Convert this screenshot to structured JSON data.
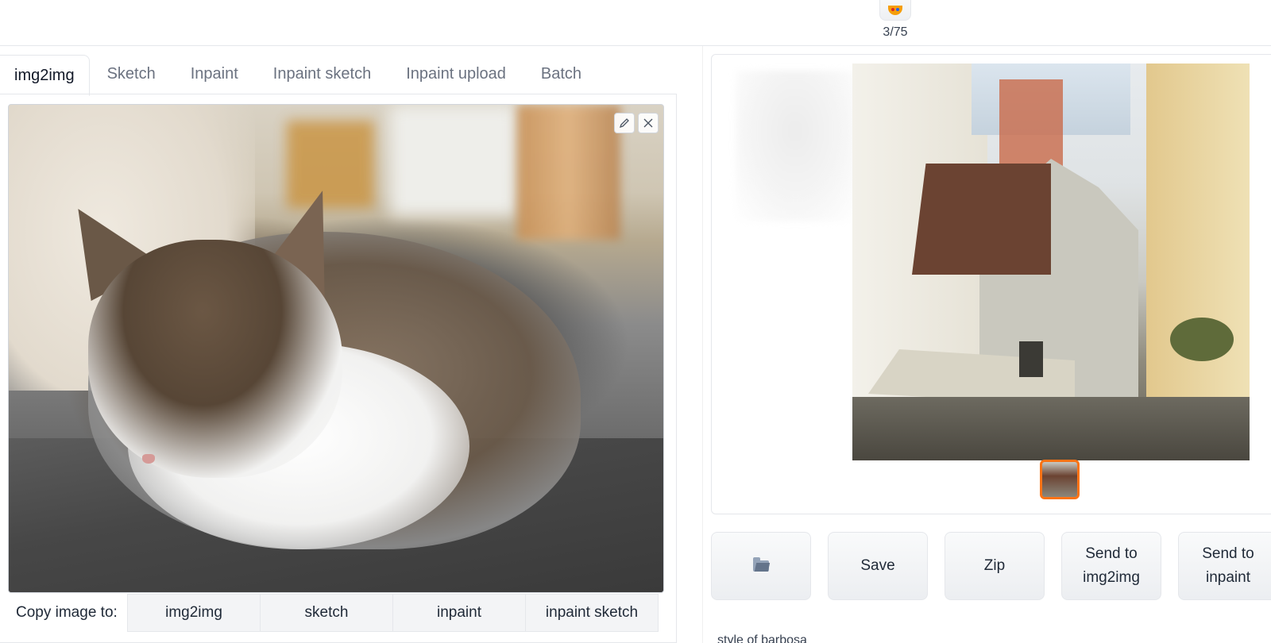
{
  "top": {
    "palette_icon": "palette-icon",
    "counter": "3/75"
  },
  "tabs": [
    {
      "label": "img2img",
      "active": true
    },
    {
      "label": "Sketch",
      "active": false
    },
    {
      "label": "Inpaint",
      "active": false
    },
    {
      "label": "Inpaint sketch",
      "active": false
    },
    {
      "label": "Inpaint upload",
      "active": false
    },
    {
      "label": "Batch",
      "active": false
    }
  ],
  "input_image": {
    "tools": {
      "edit_icon": "pencil-icon",
      "close_icon": "close-icon"
    }
  },
  "copy_row": {
    "label": "Copy image to:",
    "buttons": [
      "img2img",
      "sketch",
      "inpaint",
      "inpaint sketch"
    ]
  },
  "gallery": {
    "actions": [
      {
        "label": "",
        "icon": "folder-icon"
      },
      {
        "label": "Save"
      },
      {
        "label": "Zip"
      },
      {
        "label": "Send to img2img"
      },
      {
        "label": "Send to inpaint"
      }
    ],
    "caption": "style of barbosa"
  },
  "colors": {
    "accent": "#f97316",
    "button_bg": "#f3f4f6",
    "border": "#e5e7eb"
  }
}
